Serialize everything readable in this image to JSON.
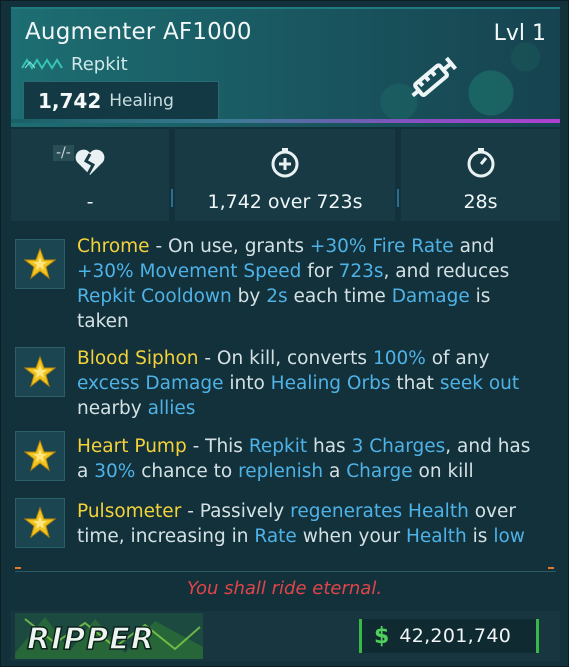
{
  "item": {
    "name": "Augmenter AF1000",
    "level": "Lvl 1",
    "type": "Repkit",
    "manufacturer_icon": "manufacturer-chevrons-icon",
    "main_stat_value": "1,742",
    "main_stat_label": "Healing",
    "item_icon": "syringe-icon",
    "rarity_color": "#b040d0"
  },
  "stats": [
    {
      "icon": "broken-heart-icon",
      "prefix": "-/-",
      "value": "-"
    },
    {
      "icon": "heal-over-time-icon",
      "value": "1,742 over 723s"
    },
    {
      "icon": "cooldown-timer-icon",
      "value": "28s"
    }
  ],
  "perks": [
    {
      "name": "Chrome",
      "segments": [
        {
          "t": " - On use, grants ",
          "h": false
        },
        {
          "t": "+30% Fire Rate",
          "h": true
        },
        {
          "t": " and ",
          "h": false
        },
        {
          "t": "+30% Movement Speed",
          "h": true
        },
        {
          "t": " for ",
          "h": false
        },
        {
          "t": "723s",
          "h": true
        },
        {
          "t": ", and reduces ",
          "h": false
        },
        {
          "t": "Repkit Cooldown",
          "h": true
        },
        {
          "t": " by ",
          "h": false
        },
        {
          "t": "2s",
          "h": true
        },
        {
          "t": " each time ",
          "h": false
        },
        {
          "t": "Damage",
          "h": true
        },
        {
          "t": " is taken",
          "h": false
        }
      ]
    },
    {
      "name": "Blood Siphon",
      "segments": [
        {
          "t": " - On kill, converts ",
          "h": false
        },
        {
          "t": "100%",
          "h": true
        },
        {
          "t": " of any ",
          "h": false
        },
        {
          "t": "excess Damage",
          "h": true
        },
        {
          "t": " into ",
          "h": false
        },
        {
          "t": "Healing Orbs",
          "h": true
        },
        {
          "t": " that ",
          "h": false
        },
        {
          "t": "seek out",
          "h": true
        },
        {
          "t": " nearby ",
          "h": false
        },
        {
          "t": "allies",
          "h": true
        }
      ]
    },
    {
      "name": "Heart Pump",
      "segments": [
        {
          "t": " - This ",
          "h": false
        },
        {
          "t": "Repkit",
          "h": true
        },
        {
          "t": " has ",
          "h": false
        },
        {
          "t": "3 Charges",
          "h": true
        },
        {
          "t": ", and has a ",
          "h": false
        },
        {
          "t": "30%",
          "h": true
        },
        {
          "t": " chance to ",
          "h": false
        },
        {
          "t": "replenish",
          "h": true
        },
        {
          "t": " a ",
          "h": false
        },
        {
          "t": "Charge",
          "h": true
        },
        {
          "t": " on kill",
          "h": false
        }
      ]
    },
    {
      "name": "Pulsometer",
      "segments": [
        {
          "t": " - Passively ",
          "h": false
        },
        {
          "t": "regenerates Health",
          "h": true
        },
        {
          "t": " over time, increasing in ",
          "h": false
        },
        {
          "t": "Rate",
          "h": true
        },
        {
          "t": " when your ",
          "h": false
        },
        {
          "t": "Health",
          "h": true
        },
        {
          "t": " is ",
          "h": false
        },
        {
          "t": "low",
          "h": true
        }
      ]
    }
  ],
  "flavor_text": "You shall ride eternal.",
  "footer": {
    "brand": "RIPPER",
    "currency_icon": "dollar-icon",
    "currency_symbol": "$",
    "price": "42,201,740"
  },
  "colors": {
    "perk_name": "#f4d23a",
    "highlight": "#4fb2e6",
    "flavor": "#e0454a",
    "price_accent": "#39b84a"
  }
}
